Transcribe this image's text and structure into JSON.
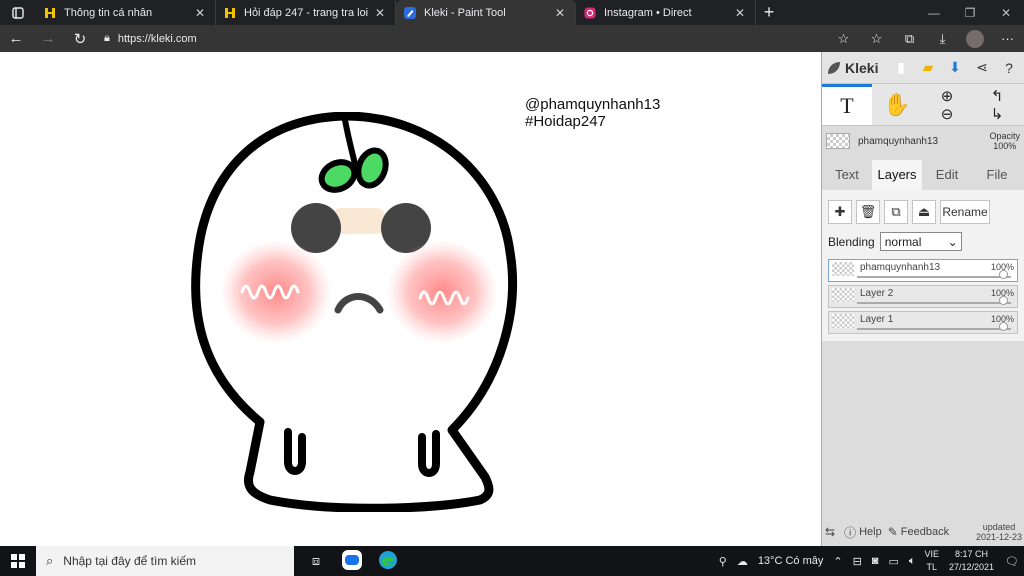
{
  "browser": {
    "tabs": [
      {
        "title": "Thông tin cá nhân",
        "icon": "hoidap-icon"
      },
      {
        "title": "Hỏi đáp 247 - trang tra loi",
        "icon": "hoidap-icon"
      },
      {
        "title": "Kleki - Paint Tool",
        "icon": "kleki-icon"
      },
      {
        "title": "Instagram • Direct",
        "icon": "instagram-icon"
      }
    ],
    "active_tab": 2,
    "url": "https://kleki.com"
  },
  "canvas": {
    "text_line1": "@phamquynhanh13",
    "text_line2": "#Hoidap247"
  },
  "panel": {
    "logo": "Kleki",
    "layer_name": "phamquynhanh13",
    "opacity_label": "Opacity",
    "opacity_value": "100%",
    "tabs": [
      "Text",
      "Layers",
      "Edit",
      "File"
    ],
    "active_tab": "Layers",
    "rename": "Rename",
    "blending_label": "Blending",
    "blending_value": "normal",
    "layers": [
      {
        "name": "phamquynhanh13",
        "opacity": "100%"
      },
      {
        "name": "Layer 2",
        "opacity": "100%"
      },
      {
        "name": "Layer 1",
        "opacity": "100%"
      }
    ],
    "help": "Help",
    "feedback": "Feedback",
    "updated_label": "updated",
    "updated_date": "2021-12-23"
  },
  "taskbar": {
    "search_placeholder": "Nhập tại đây để tìm kiếm",
    "weather": "13°C  Có mây",
    "lang1": "VIE",
    "lang2": "TL",
    "time": "8:17 CH",
    "date": "27/12/2021"
  },
  "colors": {
    "leaf": "#4cd964",
    "blush": "#ff7a7a",
    "accent": "#1d7bd8"
  }
}
